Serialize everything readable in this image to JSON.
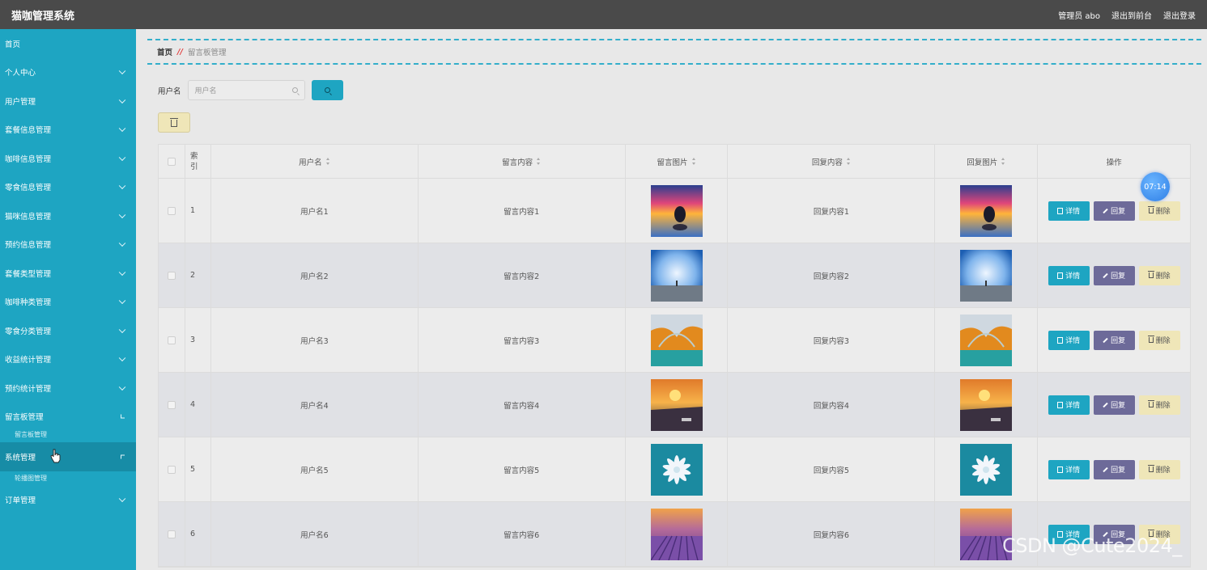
{
  "header": {
    "title": "猫咖管理系统",
    "admin": "管理员 abo",
    "front": "退出到前台",
    "logout": "退出登录"
  },
  "sidebar": {
    "items": [
      {
        "label": "首页"
      },
      {
        "label": "个人中心"
      },
      {
        "label": "用户管理"
      },
      {
        "label": "套餐信息管理"
      },
      {
        "label": "咖啡信息管理"
      },
      {
        "label": "零食信息管理"
      },
      {
        "label": "猫咪信息管理"
      },
      {
        "label": "预约信息管理"
      },
      {
        "label": "套餐类型管理"
      },
      {
        "label": "咖啡种类管理"
      },
      {
        "label": "零食分类管理"
      },
      {
        "label": "收益统计管理"
      },
      {
        "label": "预约统计管理"
      },
      {
        "label": "留言板管理"
      },
      {
        "label": "系统管理"
      },
      {
        "label": "订单管理"
      }
    ],
    "sub_board": "留言板管理",
    "sub_system": "轮播图管理"
  },
  "breadcrumb": {
    "home": "首页",
    "sep": "//",
    "current": "留言板管理"
  },
  "search": {
    "label": "用户名",
    "placeholder": "用户名"
  },
  "table": {
    "headers": {
      "index": "索引",
      "username": "用户名",
      "message": "留言内容",
      "msg_image": "留言图片",
      "reply": "回复内容",
      "reply_image": "回复图片",
      "ops": "操作"
    },
    "rows": [
      {
        "index": "1",
        "username": "用户名1",
        "message": "留言内容1",
        "reply": "回复内容1",
        "image": "sunset-island"
      },
      {
        "index": "2",
        "username": "用户名2",
        "message": "留言内容2",
        "reply": "回复内容2",
        "image": "blue-sky-person"
      },
      {
        "index": "3",
        "username": "用户名3",
        "message": "留言内容3",
        "reply": "回复内容3",
        "image": "autumn-bridge"
      },
      {
        "index": "4",
        "username": "用户名4",
        "message": "留言内容4",
        "reply": "回复内容4",
        "image": "sunset-river"
      },
      {
        "index": "5",
        "username": "用户名5",
        "message": "留言内容5",
        "reply": "回复内容5",
        "image": "white-flower"
      },
      {
        "index": "6",
        "username": "用户名6",
        "message": "留言内容6",
        "reply": "回复内容6",
        "image": "lavender-field"
      }
    ],
    "ops": {
      "detail": "详情",
      "reply": "回复",
      "delete": "删除"
    }
  },
  "timer": "07:14",
  "watermark": "CSDN @Cute2024_"
}
